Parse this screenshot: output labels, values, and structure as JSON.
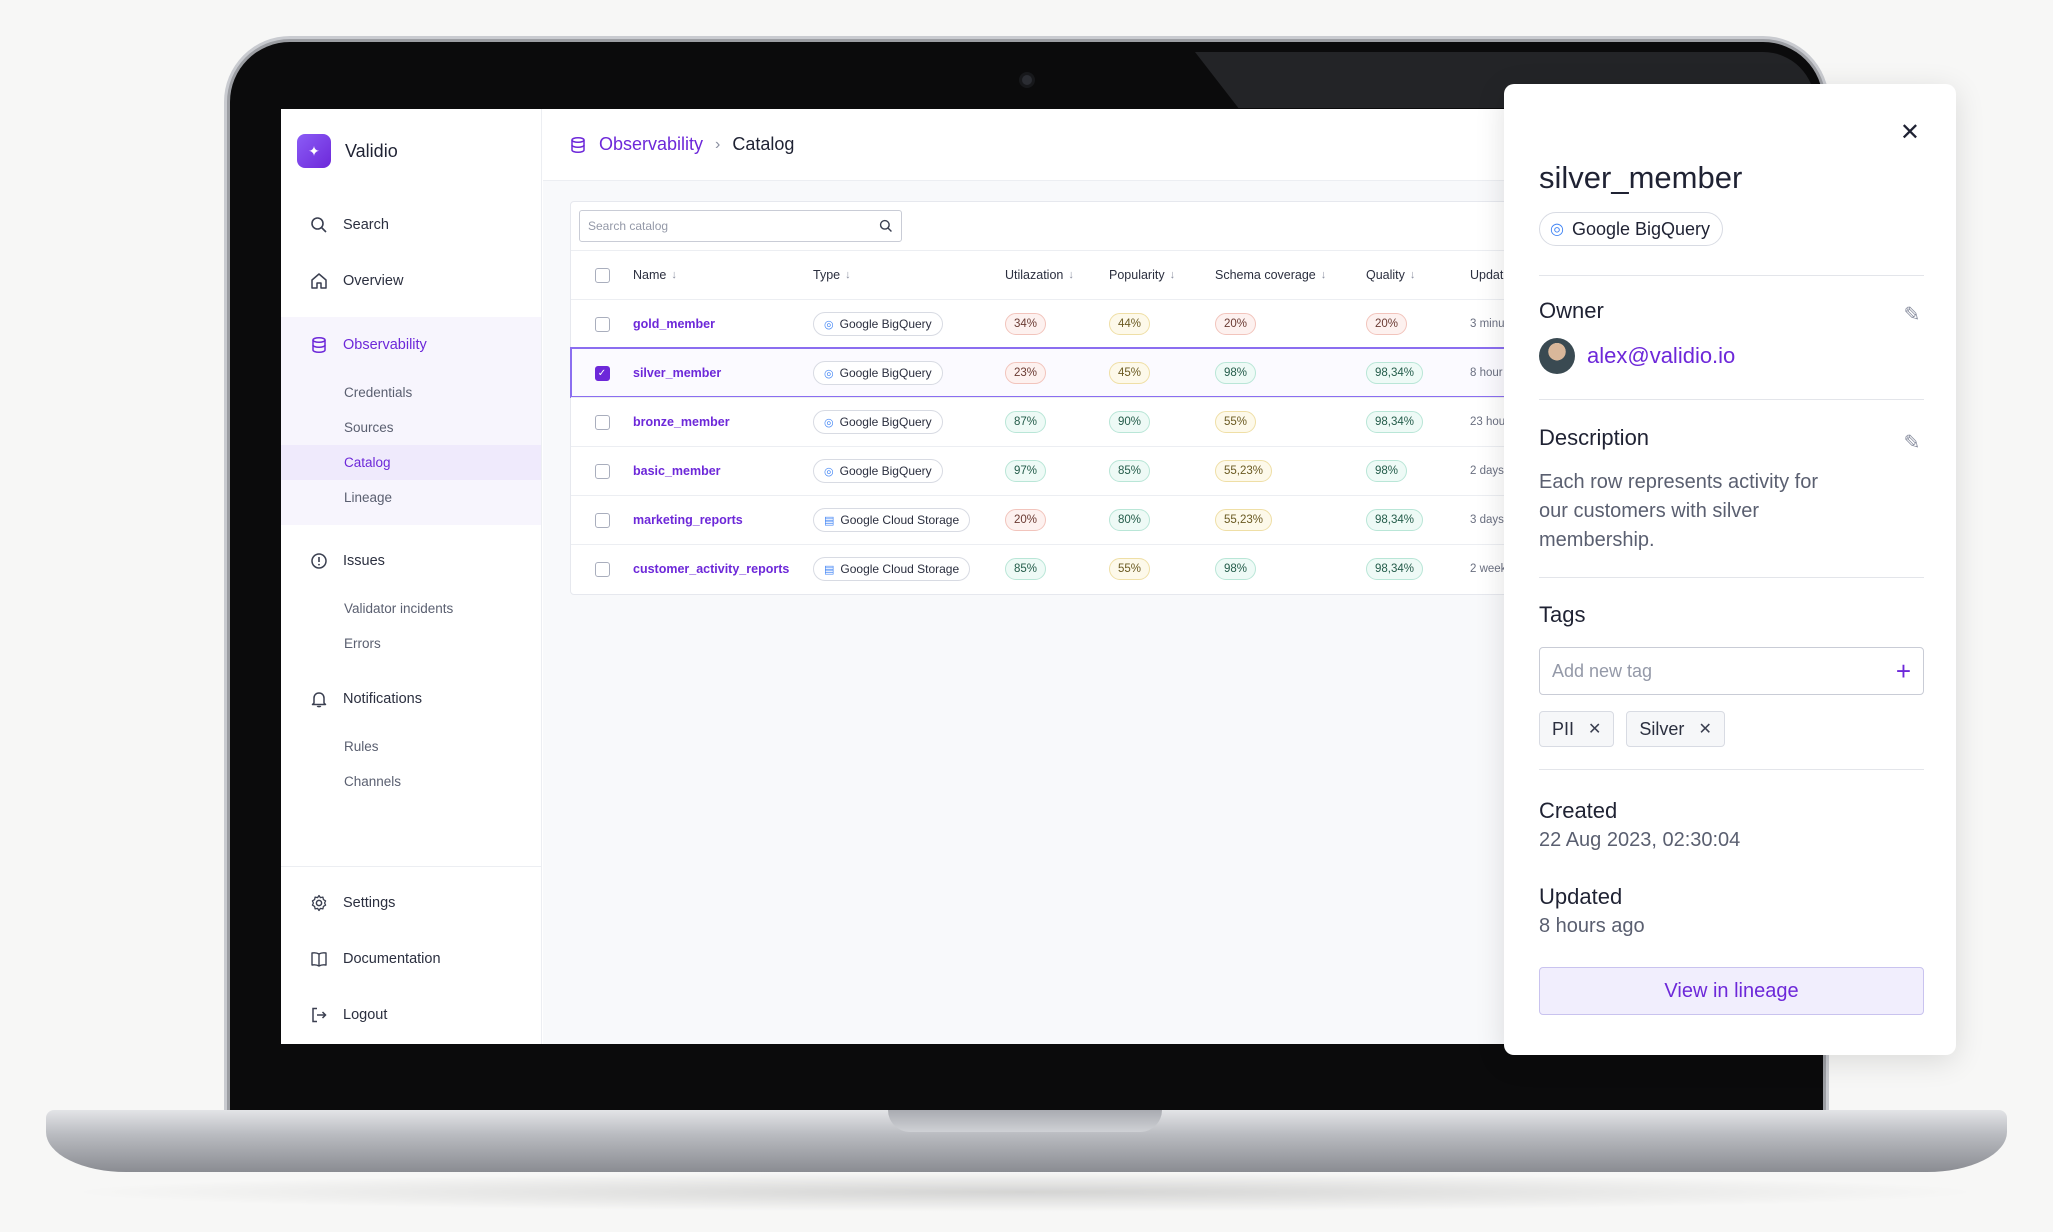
{
  "app": {
    "brand": "Validio"
  },
  "sidebar": {
    "nav": [
      {
        "label": "Search",
        "icon": "search-icon"
      },
      {
        "label": "Overview",
        "icon": "home-icon"
      },
      {
        "label": "Observability",
        "icon": "database-icon",
        "active": true,
        "children": [
          {
            "label": "Credentials"
          },
          {
            "label": "Sources"
          },
          {
            "label": "Catalog",
            "active": true
          },
          {
            "label": "Lineage"
          }
        ]
      },
      {
        "label": "Issues",
        "icon": "alert-circle-icon",
        "children": [
          {
            "label": "Validator incidents"
          },
          {
            "label": "Errors"
          }
        ]
      },
      {
        "label": "Notifications",
        "icon": "bell-icon",
        "children": [
          {
            "label": "Rules"
          },
          {
            "label": "Channels"
          }
        ]
      }
    ],
    "bottom": [
      {
        "label": "Settings",
        "icon": "gear-icon"
      },
      {
        "label": "Documentation",
        "icon": "book-icon"
      },
      {
        "label": "Logout",
        "icon": "logout-icon"
      }
    ]
  },
  "breadcrumb": {
    "parent": "Observability",
    "current": "Catalog"
  },
  "catalog": {
    "search_placeholder": "Search catalog",
    "columns": [
      "Name",
      "Type",
      "Utilazation",
      "Popularity",
      "Schema coverage",
      "Quality",
      "Updat"
    ],
    "rows": [
      {
        "name": "gold_member",
        "type": "Google BigQuery",
        "type_icon": "bigquery-icon",
        "util": "34%",
        "util_tone": "red",
        "pop": "44%",
        "pop_tone": "yel",
        "schema": "20%",
        "schema_tone": "red",
        "quality": "20%",
        "quality_tone": "red",
        "updated": "3 minu",
        "selected": false
      },
      {
        "name": "silver_member",
        "type": "Google BigQuery",
        "type_icon": "bigquery-icon",
        "util": "23%",
        "util_tone": "red",
        "pop": "45%",
        "pop_tone": "yel",
        "schema": "98%",
        "schema_tone": "grn",
        "quality": "98,34%",
        "quality_tone": "grn",
        "updated": "8 hour",
        "selected": true
      },
      {
        "name": "bronze_member",
        "type": "Google BigQuery",
        "type_icon": "bigquery-icon",
        "util": "87%",
        "util_tone": "grn",
        "pop": "90%",
        "pop_tone": "grn",
        "schema": "55%",
        "schema_tone": "yel",
        "quality": "98,34%",
        "quality_tone": "grn",
        "updated": "23 hou",
        "selected": false
      },
      {
        "name": "basic_member",
        "type": "Google BigQuery",
        "type_icon": "bigquery-icon",
        "util": "97%",
        "util_tone": "grn",
        "pop": "85%",
        "pop_tone": "grn",
        "schema": "55,23%",
        "schema_tone": "yel",
        "quality": "98%",
        "quality_tone": "grn",
        "updated": "2 days",
        "selected": false
      },
      {
        "name": "marketing_reports",
        "type": "Google Cloud Storage",
        "type_icon": "cloud-storage-icon",
        "util": "20%",
        "util_tone": "red",
        "pop": "80%",
        "pop_tone": "grn",
        "schema": "55,23%",
        "schema_tone": "yel",
        "quality": "98,34%",
        "quality_tone": "grn",
        "updated": "3 days",
        "selected": false
      },
      {
        "name": "customer_activity_reports",
        "type": "Google Cloud Storage",
        "type_icon": "cloud-storage-icon",
        "util": "85%",
        "util_tone": "grn",
        "pop": "55%",
        "pop_tone": "yel",
        "schema": "98%",
        "schema_tone": "grn",
        "quality": "98,34%",
        "quality_tone": "grn",
        "updated": "2 week",
        "selected": false
      }
    ]
  },
  "detail": {
    "title": "silver_member",
    "source": "Google BigQuery",
    "owner_label": "Owner",
    "owner_email": "alex@validio.io",
    "description_label": "Description",
    "description": "Each row represents activity for our customers with silver membership.",
    "tags_label": "Tags",
    "tag_placeholder": "Add new tag",
    "tags": [
      "PII",
      "Silver"
    ],
    "created_label": "Created",
    "created": "22 Aug 2023, 02:30:04",
    "updated_label": "Updated",
    "updated": "8 hours ago",
    "lineage_button": "View in lineage"
  },
  "colors": {
    "accent": "#6d28d9",
    "badge_red": "#fdf1ef",
    "badge_yellow": "#fdf9ea",
    "badge_green": "#eefaf6"
  }
}
